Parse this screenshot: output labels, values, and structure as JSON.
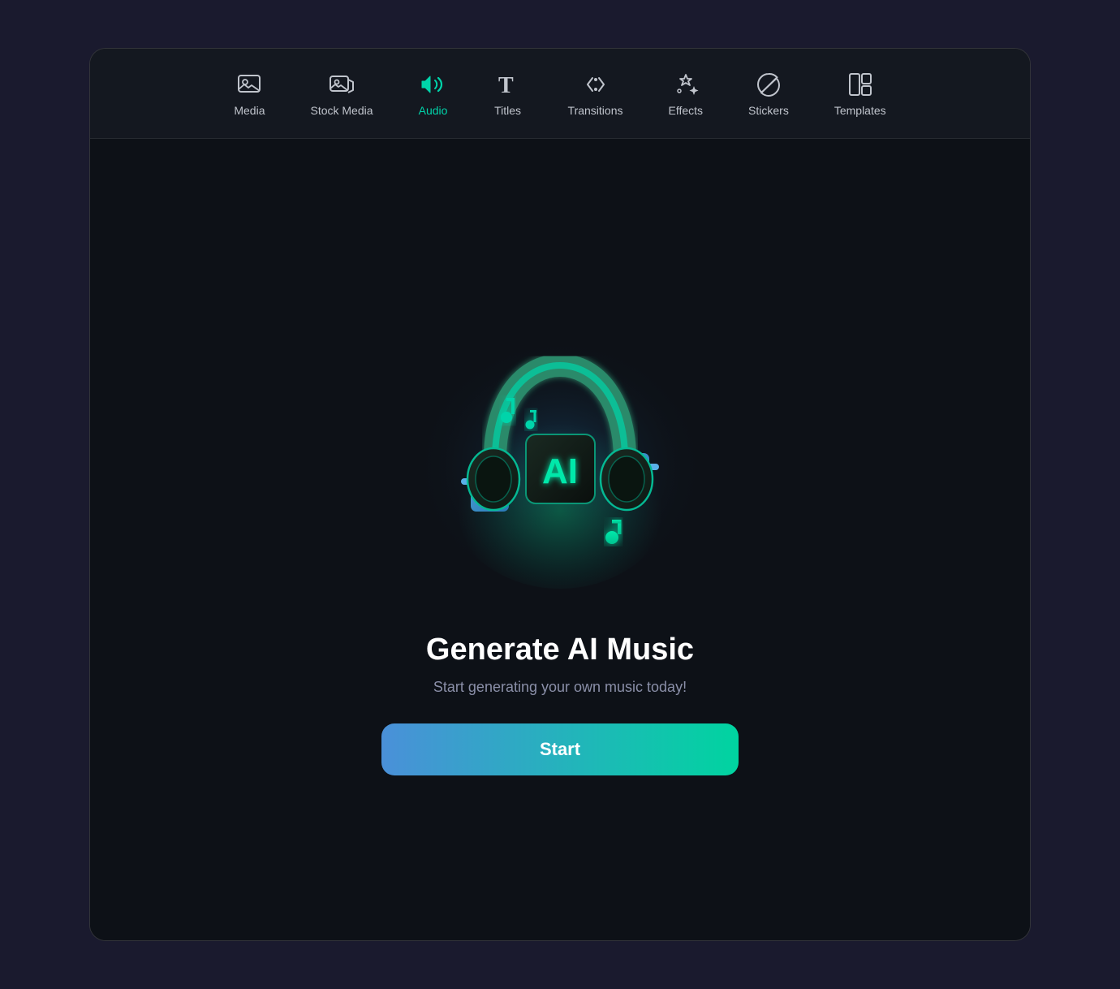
{
  "toolbar": {
    "items": [
      {
        "id": "media",
        "label": "Media",
        "active": false
      },
      {
        "id": "stock-media",
        "label": "Stock Media",
        "active": false
      },
      {
        "id": "audio",
        "label": "Audio",
        "active": true
      },
      {
        "id": "titles",
        "label": "Titles",
        "active": false
      },
      {
        "id": "transitions",
        "label": "Transitions",
        "active": false
      },
      {
        "id": "effects",
        "label": "Effects",
        "active": false
      },
      {
        "id": "stickers",
        "label": "Stickers",
        "active": false
      },
      {
        "id": "templates",
        "label": "Templates",
        "active": false
      }
    ]
  },
  "main": {
    "title": "Generate AI Music",
    "subtitle": "Start generating your own music today!",
    "start_button_label": "Start"
  }
}
